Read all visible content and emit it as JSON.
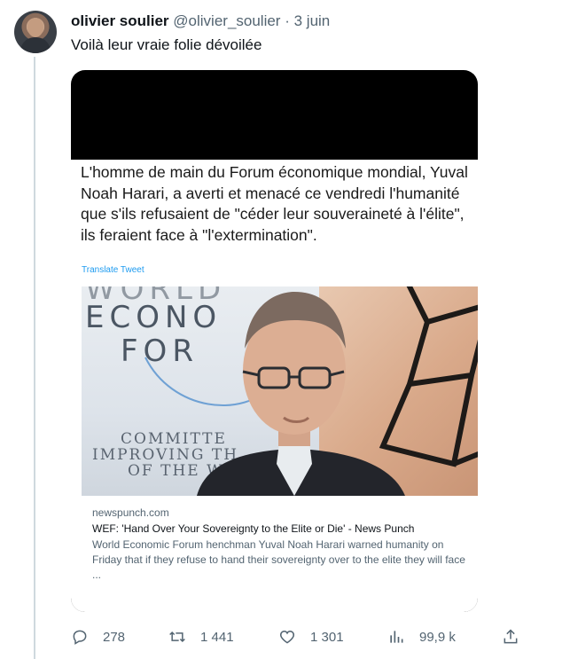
{
  "tweet": {
    "author_name": "olivier soulier",
    "author_handle": "@olivier_soulier",
    "separator": "·",
    "date": "3 juin",
    "text": "Voilà leur vraie folie dévoilée"
  },
  "embedded": {
    "quote_text": "L'homme de main du Forum économique mondial, Yuval Noah Harari, a averti et menacé ce vendredi l'humanité que s'ils refusaient de \"céder leur souveraineté à l'élite\", ils feraient face à \"l'extermination\".",
    "translate_label": "Translate Tweet",
    "card": {
      "photo_lines": [
        "WORLD",
        "ECONO",
        "FOR",
        "COMMITTE",
        "IMPROVING TH",
        "OF THE WO"
      ],
      "domain": "newspunch.com",
      "title": "WEF: 'Hand Over Your Sovereignty to the Elite or Die' - News Punch",
      "description": "World Economic Forum henchman Yuval Noah Harari warned humanity on Friday that if they refuse to hand their sovereignty over to the elite they will face ..."
    }
  },
  "actions": {
    "replies": "278",
    "retweets": "1 441",
    "likes": "1 301",
    "views": "99,9 k"
  },
  "icons": [
    "reply-icon",
    "retweet-icon",
    "like-icon",
    "views-icon",
    "share-icon"
  ],
  "colors": {
    "accent": "#1d9bf0",
    "muted": "#536471",
    "text": "#0f1419"
  }
}
